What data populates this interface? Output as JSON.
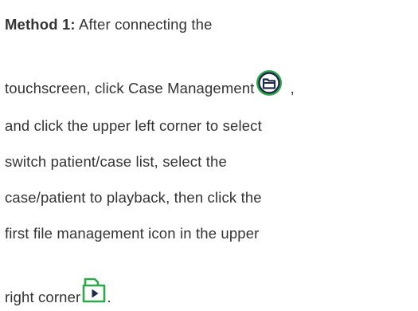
{
  "document": {
    "method_label": "Method 1:",
    "line1_text": " After connecting the",
    "line2_text": "touchscreen, click Case Management",
    "line2_tail": ",",
    "line3_text": "and click the upper left corner to select",
    "line4_text": "switch patient/case list, select the",
    "line5_text": "case/patient to playback, then click the",
    "line6_text": "first file management icon in the upper",
    "line7_text": "right corner",
    "line7_tail": "."
  },
  "icons": {
    "case_management": "folder-icon",
    "file_management": "file-play-icon"
  },
  "colors": {
    "text": "#333333",
    "icon_green": "#2ea84a",
    "icon_dark": "#1e2a4a"
  }
}
